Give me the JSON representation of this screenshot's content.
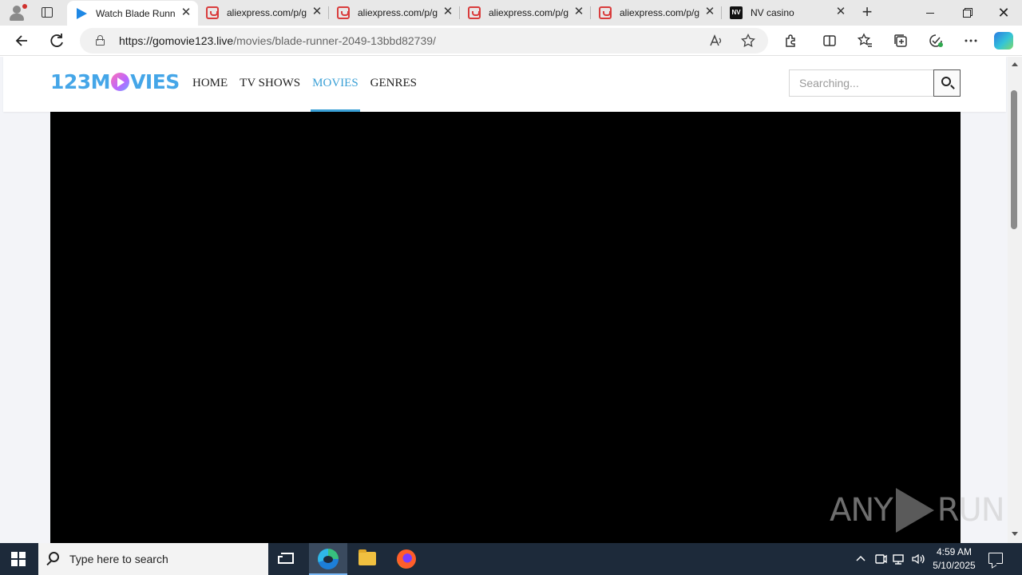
{
  "browser": {
    "tabs": [
      {
        "title": "Watch Blade Runner",
        "icon": "play-icon",
        "active": true
      },
      {
        "title": "aliexpress.com/p/g",
        "icon": "aliexpress-icon",
        "active": false
      },
      {
        "title": "aliexpress.com/p/g",
        "icon": "aliexpress-icon",
        "active": false
      },
      {
        "title": "aliexpress.com/p/g",
        "icon": "aliexpress-icon",
        "active": false
      },
      {
        "title": "aliexpress.com/p/g",
        "icon": "aliexpress-icon",
        "active": false
      },
      {
        "title": "NV casino",
        "icon": "nv-casino-icon",
        "active": false
      }
    ],
    "nv_favicon_text": "NV",
    "close_glyph": "✕",
    "new_tab_glyph": "+",
    "url_host": "https://gomovie123.live",
    "url_path": "/movies/blade-runner-2049-13bbd82739/"
  },
  "site": {
    "logo_before": "123M",
    "logo_after": "VIES",
    "nav": [
      {
        "label": "HOME",
        "active": false
      },
      {
        "label": "TV SHOWS",
        "active": false
      },
      {
        "label": "MOVIES",
        "active": true
      },
      {
        "label": "GENRES",
        "active": false
      }
    ],
    "search_placeholder": "Searching...",
    "accent_color": "#3aa0d6",
    "logo_color": "#45a6e8"
  },
  "watermark": {
    "left": "ANY",
    "right": "RUN"
  },
  "taskbar": {
    "search_placeholder": "Type here to search",
    "time": "4:59 AM",
    "date": "5/10/2025",
    "pinned": [
      "task-view-icon",
      "edge-icon",
      "file-explorer-icon",
      "firefox-icon"
    ]
  }
}
